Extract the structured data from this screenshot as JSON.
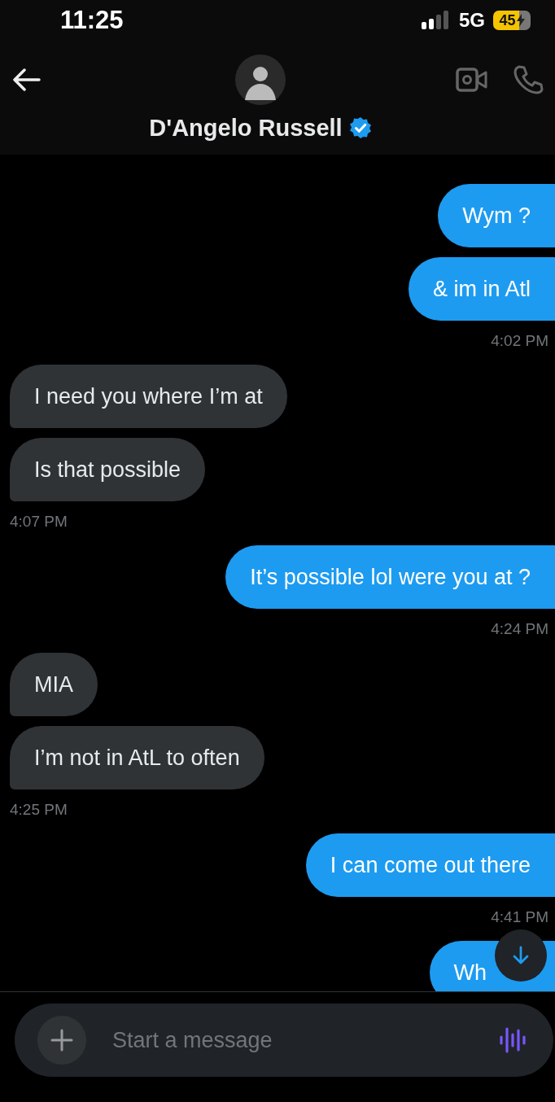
{
  "status_bar": {
    "time": "11:25",
    "network": "5G",
    "battery": "45",
    "charging": true
  },
  "header": {
    "name": "D'Angelo Russell",
    "verified": true
  },
  "messages": [
    {
      "kind": "sent",
      "bubbles": [
        "Wym ?",
        "& im in Atl"
      ],
      "time": "4:02 PM"
    },
    {
      "kind": "received",
      "bubbles": [
        "I need you where I’m at",
        "Is that possible"
      ],
      "time": "4:07 PM"
    },
    {
      "kind": "sent",
      "bubbles": [
        "It’s possible lol were you at ?"
      ],
      "time": "4:24 PM"
    },
    {
      "kind": "received",
      "bubbles": [
        "MIA",
        "I’m not in AtL to often"
      ],
      "time": "4:25 PM"
    },
    {
      "kind": "sent",
      "bubbles": [
        "I can come out there"
      ],
      "time": "4:41 PM"
    },
    {
      "kind": "sent",
      "bubbles": [
        "Wh"
      ]
    }
  ],
  "composer": {
    "placeholder": "Start a message"
  }
}
